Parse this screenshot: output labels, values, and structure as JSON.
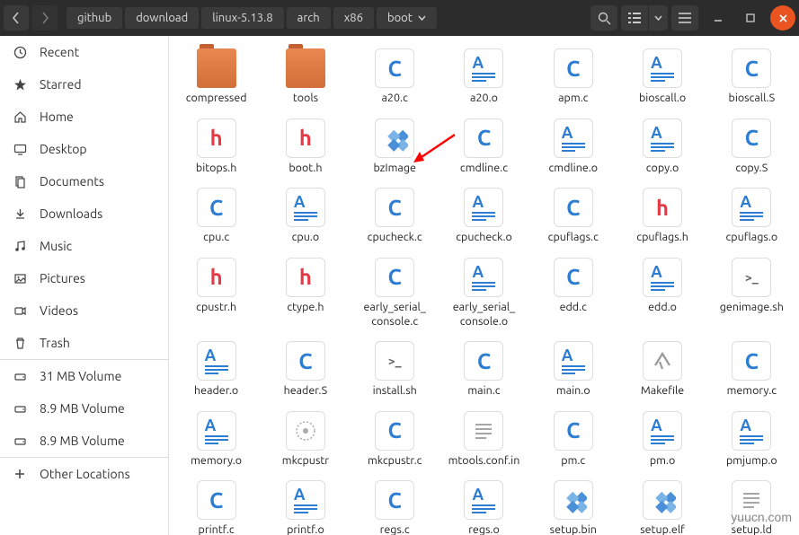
{
  "breadcrumb": [
    "github",
    "download",
    "linux-5.13.8",
    "arch",
    "x86",
    "boot"
  ],
  "sidebar": {
    "items": [
      {
        "label": "Recent",
        "icon": "clock"
      },
      {
        "label": "Starred",
        "icon": "star"
      },
      {
        "label": "Home",
        "icon": "home"
      },
      {
        "label": "Desktop",
        "icon": "desktop"
      },
      {
        "label": "Documents",
        "icon": "documents"
      },
      {
        "label": "Downloads",
        "icon": "download"
      },
      {
        "label": "Music",
        "icon": "music"
      },
      {
        "label": "Pictures",
        "icon": "pictures"
      },
      {
        "label": "Videos",
        "icon": "video"
      },
      {
        "label": "Trash",
        "icon": "trash"
      }
    ],
    "volumes": [
      {
        "label": "31 MB Volume"
      },
      {
        "label": "8.9 MB Volume"
      },
      {
        "label": "8.9 MB Volume"
      }
    ],
    "other": {
      "label": "Other Locations"
    }
  },
  "files": [
    {
      "name": "compressed",
      "type": "folder"
    },
    {
      "name": "tools",
      "type": "folder"
    },
    {
      "name": "a20.c",
      "type": "c"
    },
    {
      "name": "a20.o",
      "type": "o"
    },
    {
      "name": "apm.c",
      "type": "c"
    },
    {
      "name": "bioscall.o",
      "type": "o"
    },
    {
      "name": "bioscall.S",
      "type": "c"
    },
    {
      "name": "bitops.h",
      "type": "h"
    },
    {
      "name": "boot.h",
      "type": "h"
    },
    {
      "name": "bzImage",
      "type": "bin"
    },
    {
      "name": "cmdline.c",
      "type": "c"
    },
    {
      "name": "cmdline.o",
      "type": "o"
    },
    {
      "name": "copy.o",
      "type": "o"
    },
    {
      "name": "copy.S",
      "type": "c"
    },
    {
      "name": "cpu.c",
      "type": "c"
    },
    {
      "name": "cpu.o",
      "type": "o"
    },
    {
      "name": "cpucheck.c",
      "type": "c"
    },
    {
      "name": "cpucheck.o",
      "type": "o"
    },
    {
      "name": "cpuflags.c",
      "type": "c"
    },
    {
      "name": "cpuflags.h",
      "type": "h"
    },
    {
      "name": "cpuflags.o",
      "type": "o"
    },
    {
      "name": "cpustr.h",
      "type": "h"
    },
    {
      "name": "ctype.h",
      "type": "h"
    },
    {
      "name": "early_serial_console.c",
      "type": "c"
    },
    {
      "name": "early_serial_console.o",
      "type": "o"
    },
    {
      "name": "edd.c",
      "type": "c"
    },
    {
      "name": "edd.o",
      "type": "o"
    },
    {
      "name": "genimage.sh",
      "type": "sh"
    },
    {
      "name": "header.o",
      "type": "o"
    },
    {
      "name": "header.S",
      "type": "c"
    },
    {
      "name": "install.sh",
      "type": "sh"
    },
    {
      "name": "main.c",
      "type": "c"
    },
    {
      "name": "main.o",
      "type": "o"
    },
    {
      "name": "Makefile",
      "type": "make"
    },
    {
      "name": "memory.c",
      "type": "c"
    },
    {
      "name": "memory.o",
      "type": "o"
    },
    {
      "name": "mkcpustr",
      "type": "bin2"
    },
    {
      "name": "mkcpustr.c",
      "type": "c"
    },
    {
      "name": "mtools.conf.in",
      "type": "txt"
    },
    {
      "name": "pm.c",
      "type": "c"
    },
    {
      "name": "pm.o",
      "type": "o"
    },
    {
      "name": "pmjump.o",
      "type": "o"
    },
    {
      "name": "printf.c",
      "type": "c"
    },
    {
      "name": "printf.o",
      "type": "o"
    },
    {
      "name": "regs.c",
      "type": "c"
    },
    {
      "name": "regs.o",
      "type": "o"
    },
    {
      "name": "setup.bin",
      "type": "bin"
    },
    {
      "name": "setup.elf",
      "type": "bin"
    },
    {
      "name": "setup.ld",
      "type": "txt"
    }
  ],
  "watermark": "yuucn.com"
}
